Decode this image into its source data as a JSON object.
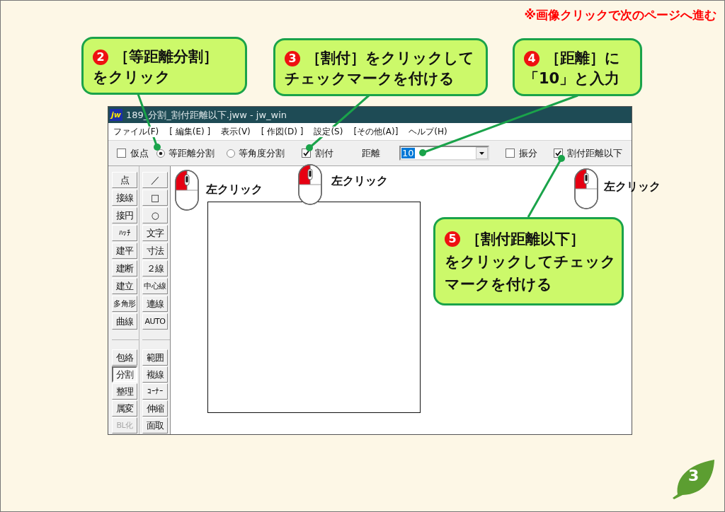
{
  "notice": "※画像クリックで次のページへ進む",
  "window": {
    "icon_text": "jw",
    "title": "189_分割_割付距離以下.jww - jw_win"
  },
  "menu": [
    "ファイル(F)",
    "[ 編集(E) ]",
    "表示(V)",
    "[ 作図(D) ]",
    "設定(S)",
    "[その他(A)]",
    "ヘルプ(H)"
  ],
  "toolbar": [
    {
      "kind": "checkbox",
      "label": "仮点",
      "checked": false
    },
    {
      "kind": "radio",
      "label": "等距離分割",
      "selected": true
    },
    {
      "kind": "radio",
      "label": "等角度分割",
      "selected": false
    },
    {
      "kind": "checkbox",
      "label": "割付",
      "checked": true
    },
    {
      "kind": "combo",
      "label": "距離",
      "value": "10",
      "highlighted": true
    },
    {
      "kind": "checkbox",
      "label": "振分",
      "checked": false
    },
    {
      "kind": "checkbox",
      "label": "割付距離以下",
      "checked": true
    }
  ],
  "toolbox": {
    "sections": [
      {
        "rows": [
          [
            {
              "label": "点",
              "pressed": false,
              "disabled": false
            },
            {
              "label": "／",
              "pressed": false,
              "disabled": false
            }
          ],
          [
            {
              "label": "接線",
              "pressed": false,
              "disabled": false
            },
            {
              "label": "□",
              "pressed": false,
              "disabled": false
            }
          ],
          [
            {
              "label": "接円",
              "pressed": false,
              "disabled": false
            },
            {
              "label": "○",
              "pressed": false,
              "disabled": false
            }
          ],
          [
            {
              "label": "ﾊｯﾁ",
              "pressed": false,
              "disabled": false
            },
            {
              "label": "文字",
              "pressed": false,
              "disabled": false
            }
          ],
          [
            {
              "label": "建平",
              "pressed": false,
              "disabled": false
            },
            {
              "label": "寸法",
              "pressed": false,
              "disabled": false
            }
          ],
          [
            {
              "label": "建断",
              "pressed": false,
              "disabled": false
            },
            {
              "label": "２線",
              "pressed": false,
              "disabled": false
            }
          ],
          [
            {
              "label": "建立",
              "pressed": false,
              "disabled": false
            },
            {
              "label": "中心線",
              "pressed": false,
              "disabled": false
            }
          ],
          [
            {
              "label": "多角形",
              "pressed": false,
              "disabled": false
            },
            {
              "label": "連線",
              "pressed": false,
              "disabled": false
            }
          ],
          [
            {
              "label": "曲線",
              "pressed": false,
              "disabled": false
            },
            {
              "label": "AUTO",
              "pressed": false,
              "disabled": false
            }
          ]
        ]
      },
      {
        "rows": [
          [
            {
              "label": "包絡",
              "pressed": false,
              "disabled": false
            },
            {
              "label": "範囲",
              "pressed": false,
              "disabled": false
            }
          ],
          [
            {
              "label": "分割",
              "pressed": true,
              "disabled": false
            },
            {
              "label": "複線",
              "pressed": false,
              "disabled": false
            }
          ],
          [
            {
              "label": "整理",
              "pressed": false,
              "disabled": false
            },
            {
              "label": "ｺｰﾅｰ",
              "pressed": false,
              "disabled": false
            }
          ],
          [
            {
              "label": "属変",
              "pressed": false,
              "disabled": false
            },
            {
              "label": "伸縮",
              "pressed": false,
              "disabled": false
            }
          ],
          [
            {
              "label": "BL化",
              "pressed": false,
              "disabled": true
            },
            {
              "label": "面取",
              "pressed": false,
              "disabled": false
            }
          ]
        ]
      }
    ]
  },
  "mouse_hints": [
    {
      "label": "左クリック"
    },
    {
      "label": "左クリック"
    },
    {
      "label": "左クリック"
    }
  ],
  "callouts": [
    {
      "number": "2",
      "lines": [
        "［等距離分割］",
        "をクリック"
      ]
    },
    {
      "number": "3",
      "lines": [
        "［割付］をクリックして",
        "チェックマークを付ける"
      ]
    },
    {
      "number": "4",
      "lines": [
        "［距離］に",
        "「10」と入力"
      ]
    },
    {
      "number": "5",
      "lines": [
        "［割付距離以下］",
        "をクリックしてチェック",
        "マークを付ける"
      ]
    }
  ],
  "page_number": "3"
}
